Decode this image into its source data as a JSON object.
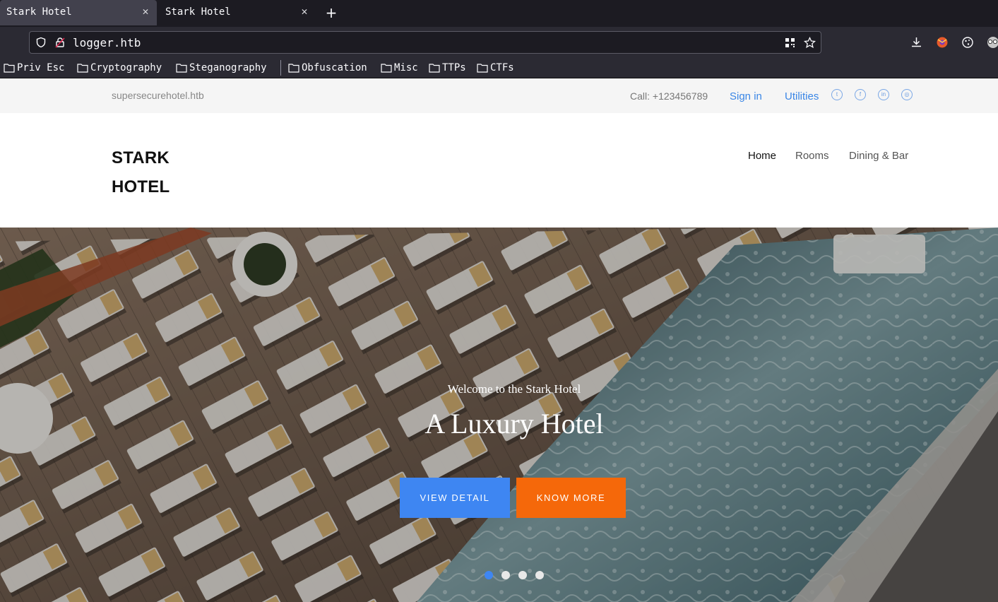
{
  "browser": {
    "tabs": [
      {
        "title": "Stark Hotel",
        "active": true
      },
      {
        "title": "Stark Hotel",
        "active": false
      }
    ],
    "url": "logger.htb",
    "bookmarks": [
      "Priv Esc",
      "Cryptography",
      "Steganography",
      "Obfuscation",
      "Misc",
      "TTPs",
      "CTFs"
    ]
  },
  "topbar": {
    "domain": "supersecurehotel.htb",
    "call": "Call: +123456789",
    "sign_in": "Sign in",
    "utilities": "Utilities",
    "social_icons": [
      "twitter-icon",
      "facebook-icon",
      "linkedin-icon",
      "dribbble-icon"
    ]
  },
  "header": {
    "logo_line1": "STARK",
    "logo_line2": "HOTEL",
    "nav": [
      "Home",
      "Rooms",
      "Dining & Bar"
    ]
  },
  "hero": {
    "subtitle": "Welcome to the Stark Hotel",
    "title": "A Luxury Hotel",
    "primary_button": "View Detail",
    "secondary_button": "Know More",
    "slides_count": 4,
    "active_slide": 0
  },
  "colors": {
    "accent_blue": "#3e86f2",
    "accent_orange": "#f5680a",
    "link_blue": "#3a86e6",
    "chrome_dark": "#1c1b22",
    "chrome_mid": "#2b2a33"
  }
}
